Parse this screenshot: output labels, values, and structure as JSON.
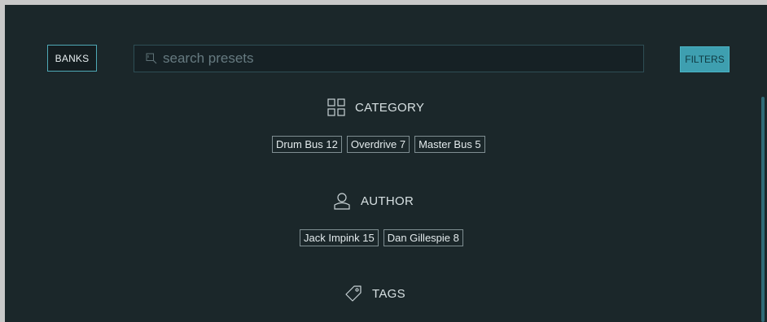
{
  "toolbar": {
    "banks_label": "BANKS",
    "search_placeholder": "search presets",
    "search_value": "",
    "filters_label": "FILTERS"
  },
  "sections": {
    "category": {
      "title": "CATEGORY",
      "icon": "grid-icon",
      "chips": [
        "Drum Bus 12",
        "Overdrive 7",
        "Master Bus 5"
      ]
    },
    "author": {
      "title": "AUTHOR",
      "icon": "user-icon",
      "chips": [
        "Jack Impink 15",
        "Dan Gillespie 8"
      ]
    },
    "tags": {
      "title": "TAGS",
      "icon": "tag-icon"
    }
  },
  "colors": {
    "background": "#1b272a",
    "accent": "#3e9fb0",
    "text": "#d7e0e2"
  }
}
